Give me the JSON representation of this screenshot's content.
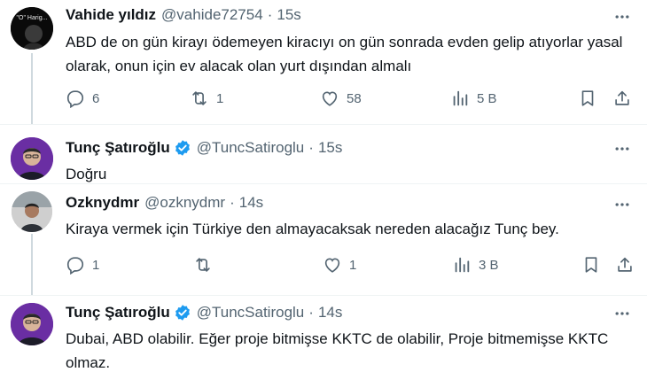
{
  "tweets": [
    {
      "name": "Vahide yıldız",
      "handle": "@vahide72754",
      "time": "15s",
      "text": "ABD de on gün kirayı ödemeyen kiracıyı  on gün sonrada evden gelip atıyorlar yasal olarak, onun için ev alacak olan yurt dışından almalı",
      "avatar_text": "\"O\" Harig...",
      "replies": "6",
      "retweets": "1",
      "likes": "58",
      "views": "5 B"
    },
    {
      "name": "Tunç Şatıroğlu",
      "handle": "@TuncSatiroglu",
      "time": "15s",
      "text": "Doğru",
      "verified": true
    },
    {
      "name": "Ozknydmr",
      "handle": "@ozknydmr",
      "time": "14s",
      "text": "Kiraya vermek için Türkiye den almayacaksak nereden alacağız  Tunç bey.",
      "replies": "1",
      "retweets": "",
      "likes": "1",
      "views": "3 B"
    },
    {
      "name": "Tunç Şatıroğlu",
      "handle": "@TuncSatiroglu",
      "time": "14s",
      "text": "Dubai, ABD olabilir. Eğer proje bitmişse KKTC de olabilir, Proje bitmemişse KKTC olmaz.",
      "verified": true
    }
  ],
  "separator": "·",
  "colors": {
    "verified": "#1d9bf0",
    "muted": "#536471",
    "line": "#cfd9de"
  },
  "icons": [
    "more-icon",
    "reply-icon",
    "retweet-icon",
    "like-icon",
    "views-icon",
    "bookmark-icon",
    "share-icon",
    "verified-icon"
  ]
}
